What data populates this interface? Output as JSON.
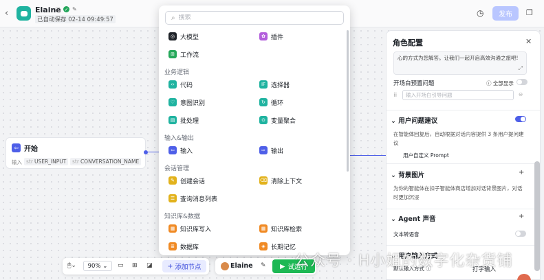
{
  "header": {
    "app_name": "Elaine",
    "saved_status": "已自动保存 02-14 09:49:57",
    "publish_label": "发布",
    "icons": [
      "back-chevron-icon",
      "info-icon",
      "verified-check-icon",
      "edit-icon",
      "history-icon",
      "duplicate-icon"
    ]
  },
  "start_node": {
    "title": "开始",
    "input_label": "输入",
    "params": [
      {
        "type": "str",
        "name": "USER_INPUT"
      },
      {
        "type": "str",
        "name": "CONVERSATION_NAME"
      }
    ]
  },
  "picker": {
    "search_placeholder": "搜索",
    "top_items": [
      {
        "label": "大模型",
        "color": "#1f2329"
      },
      {
        "label": "插件",
        "color": "#b35fdc"
      },
      {
        "label": "工作流",
        "color": "#25a85a"
      }
    ],
    "sections": [
      {
        "title": "业务逻辑",
        "items": [
          {
            "label": "代码",
            "color": "#1fb3a0"
          },
          {
            "label": "选择器",
            "color": "#1fb3a0"
          },
          {
            "label": "意图识别",
            "color": "#1fb3a0"
          },
          {
            "label": "循环",
            "color": "#1fb3a0"
          },
          {
            "label": "批处理",
            "color": "#1fb3a0"
          },
          {
            "label": "变量聚合",
            "color": "#1fb3a0"
          }
        ]
      },
      {
        "title": "输入&输出",
        "items": [
          {
            "label": "输入",
            "color": "#4e5fe8"
          },
          {
            "label": "输出",
            "color": "#4e5fe8"
          }
        ]
      },
      {
        "title": "会话管理",
        "items": [
          {
            "label": "创建会话",
            "color": "#e2b21c"
          },
          {
            "label": "清除上下文",
            "color": "#e2b21c"
          },
          {
            "label": "查询消息列表",
            "color": "#e2b21c"
          }
        ]
      },
      {
        "title": "知识库&数据",
        "items": [
          {
            "label": "知识库写入",
            "color": "#f08a24"
          },
          {
            "label": "知识库检索",
            "color": "#f08a24"
          },
          {
            "label": "数据库",
            "color": "#f08a24"
          },
          {
            "label": "长期记忆",
            "color": "#f08a24"
          }
        ]
      }
    ]
  },
  "panel": {
    "title": "角色配置",
    "prompt_text": "心的方式为您解答。让我们一起开启高效沟通之旅吧!",
    "opening_label": "开场白预置问题",
    "show_all_label": "全部显示",
    "opening_placeholder": "输入开场白引导问题",
    "suggest_title": "用户问题建议",
    "suggest_desc": "在智能体回复后，自动根据对话内容提供 3 条用户提问建议",
    "custom_prompt_label": "用户自定义 Prompt",
    "bg_title": "背景图片",
    "bg_desc": "为你的智能体在扣子智能体商店增加对话背景图片，对话时更加沉浸",
    "voice_title": "Agent 声音",
    "tts_label": "文本转语音",
    "input_title": "用户输入方式",
    "default_input_label": "默认输入方式",
    "default_input_value": "打字输入"
  },
  "toolbar": {
    "zoom": "90%",
    "add_node_label": "添加节点",
    "user_name": "Elaine",
    "run_label": "试运行"
  },
  "watermark": "公众号 · H小姐的数字化杂货铺"
}
